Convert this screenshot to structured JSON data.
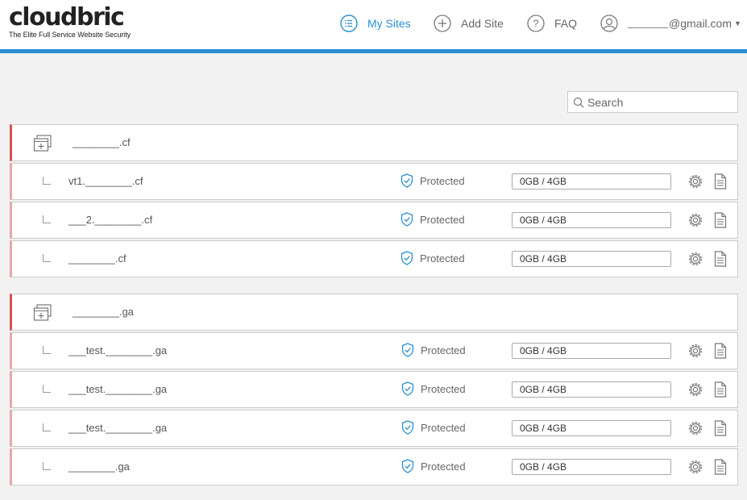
{
  "header": {
    "logo_text": "cloudbric",
    "tagline": "The Elite Full Service Website Security",
    "nav": [
      {
        "label": "My Sites",
        "icon": "list-circle-icon",
        "active": true
      },
      {
        "label": "Add Site",
        "icon": "plus-circle-icon",
        "active": false
      },
      {
        "label": "FAQ",
        "icon": "question-circle-icon",
        "active": false
      }
    ],
    "user_email_suffix": "@gmail.com",
    "user_icon": "user-circle-icon",
    "accent_color": "#2a8fd1"
  },
  "search": {
    "placeholder": "Search"
  },
  "groups": [
    {
      "domain": "________.cf",
      "sites": [
        {
          "domain": "vt1.________.cf",
          "status": "Protected",
          "usage": "0GB / 4GB"
        },
        {
          "domain": "___2.________.cf",
          "status": "Protected",
          "usage": "0GB / 4GB"
        },
        {
          "domain": "________.cf",
          "status": "Protected",
          "usage": "0GB / 4GB"
        }
      ]
    },
    {
      "domain": "________.ga",
      "sites": [
        {
          "domain": "___test.________.ga",
          "status": "Protected",
          "usage": "0GB / 4GB"
        },
        {
          "domain": "___test.________.ga",
          "status": "Protected",
          "usage": "0GB / 4GB"
        },
        {
          "domain": "___test.________.ga",
          "status": "Protected",
          "usage": "0GB / 4GB"
        },
        {
          "domain": "________.ga",
          "status": "Protected",
          "usage": "0GB / 4GB"
        }
      ]
    }
  ],
  "colors": {
    "group_border": "#d9534f",
    "site_border": "#e8a8a6",
    "protected_shield": "#2a8fd1"
  }
}
